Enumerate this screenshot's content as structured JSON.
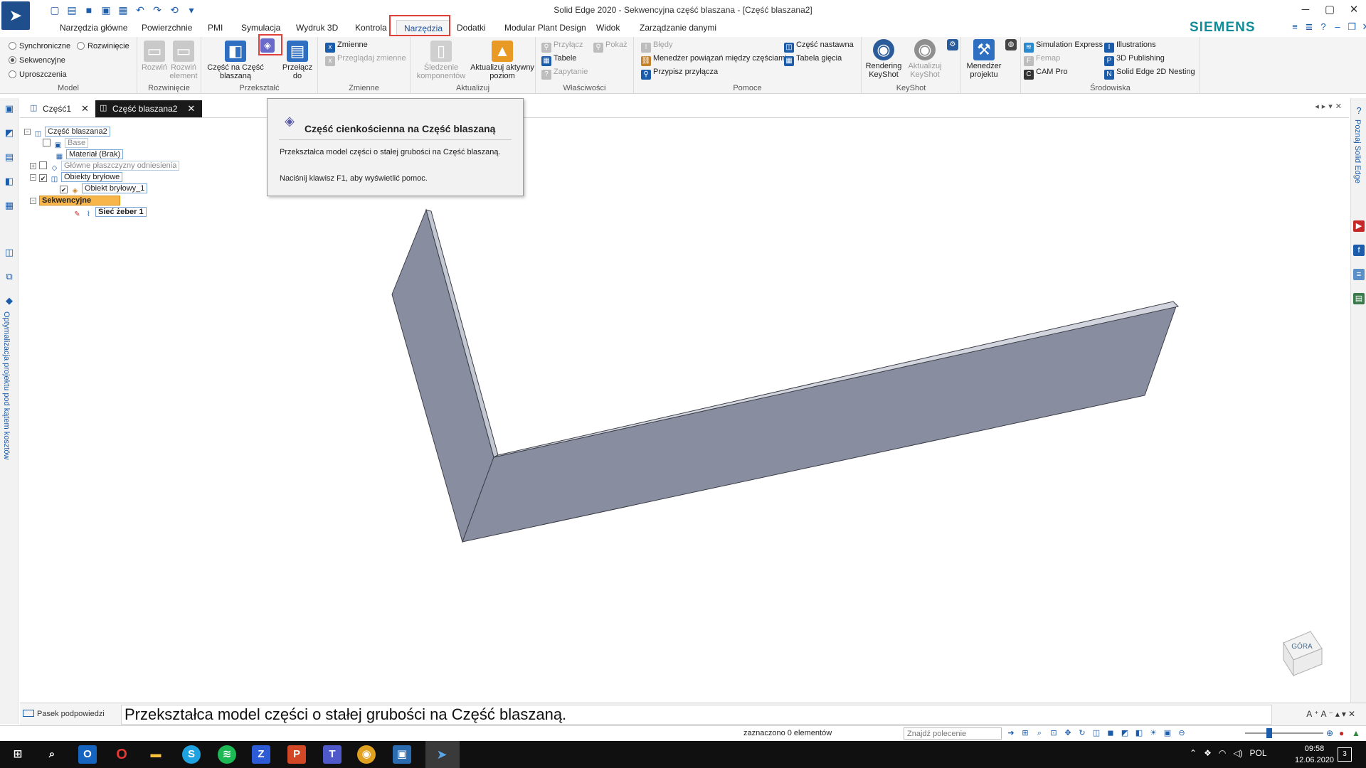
{
  "window": {
    "title": "Solid Edge 2020 - Sekwencyjna część blaszana - [Część blaszana2]",
    "brand": "SIEMENS"
  },
  "ribbon_tabs": [
    "Narzędzia główne",
    "Powierzchnie",
    "PMI",
    "Symulacja",
    "Wydruk 3D",
    "Kontrola",
    "Narzędzia",
    "Dodatki",
    "Modular Plant Design",
    "Widok",
    "Zarządzanie danymi"
  ],
  "active_tab": "Narzędzia",
  "groups": {
    "model": {
      "label": "Model",
      "synchronous": "Synchroniczne",
      "unfold": "Rozwinięcie",
      "sequential": "Sekwencyjne",
      "simplify": "Uproszczenia"
    },
    "rozwiniecie": {
      "label": "Rozwinięcie",
      "unfold_btn": "Rozwiń",
      "unfold_elem_btn": "Rozwiń element"
    },
    "przeksztalc": {
      "label": "Przekształć",
      "to_sheet_btn": "Część na Część blaszaną",
      "switch_btn": "Przełącz do"
    },
    "zmienne": {
      "label": "Zmienne",
      "variables": "Zmienne",
      "browse_variables": "Przeglądaj zmienne"
    },
    "aktualizuj": {
      "label": "Aktualizuj",
      "track_components": "Śledzenie komponentów",
      "update_active_level": "Aktualizuj aktywny poziom"
    },
    "wlasciwosci": {
      "label": "Właściwości",
      "attach": "Przyłącz",
      "show": "Pokaż",
      "tables": "Tabele",
      "query": "Zapytanie"
    },
    "pomoce": {
      "label": "Pomoce",
      "errors": "Błędy",
      "relations_manager": "Menedżer powiązań między częściami",
      "assign_attachment": "Przypisz przyłącza",
      "family_part": "Część nastawna",
      "bend_table": "Tabela gięcia"
    },
    "keyshot": {
      "label": "KeyShot",
      "rendering": "Rendering KeyShot",
      "update_keyshot": "Aktualizuj KeyShot"
    },
    "project": {
      "manager": "Menedżer projektu"
    },
    "srodowiska": {
      "label": "Środowiska",
      "simulation_express": "Simulation Express",
      "femap": "Femap",
      "cam_pro": "CAM Pro",
      "illustrations": "Illustrations",
      "publishing_3d": "3D Publishing",
      "nesting_2d": "Solid Edge 2D Nesting"
    }
  },
  "doc_tabs": [
    {
      "label": "Część1"
    },
    {
      "label": "Część blaszana2"
    }
  ],
  "tree": {
    "root": "Część blaszana2",
    "base": "Base",
    "material": "Materiał (Brak)",
    "ref_planes": "Główne płaszczyzny odniesienia",
    "solid_bodies": "Obiekty bryłowe",
    "solid_body_1": "Obiekt bryłowy_1",
    "sequential": "Sekwencyjne",
    "rib_network": "Sieć żeber 1"
  },
  "tooltip": {
    "title": "Część cienkościenna na Część blaszaną",
    "description": "Przekształca model części o stałej grubości na Część blaszaną.",
    "help": "Naciśnij klawisz F1, aby wyświetlić pomoc."
  },
  "side_panels": {
    "left": "Optymalizacja projektu pod kątem kosztów",
    "right": "Poznaj Solid Edge"
  },
  "view_cube_label": "GÓRA",
  "prompt": {
    "label": "Pasek podpowiedzi",
    "text": "Przekształca model części o stałej grubości na Część blaszaną."
  },
  "status": {
    "selection": "zaznaczono 0 elementów",
    "find_placeholder": "Znajdź polecenie"
  },
  "taskbar": {
    "language": "POL",
    "time": "09:58",
    "date": "12.06.2020",
    "notifications": "3"
  },
  "colors": {
    "accent": "#1b4f9c",
    "highlight_box": "#e0403a",
    "tree_highlight": "#f7b54a",
    "model_face": "#888ea0"
  }
}
